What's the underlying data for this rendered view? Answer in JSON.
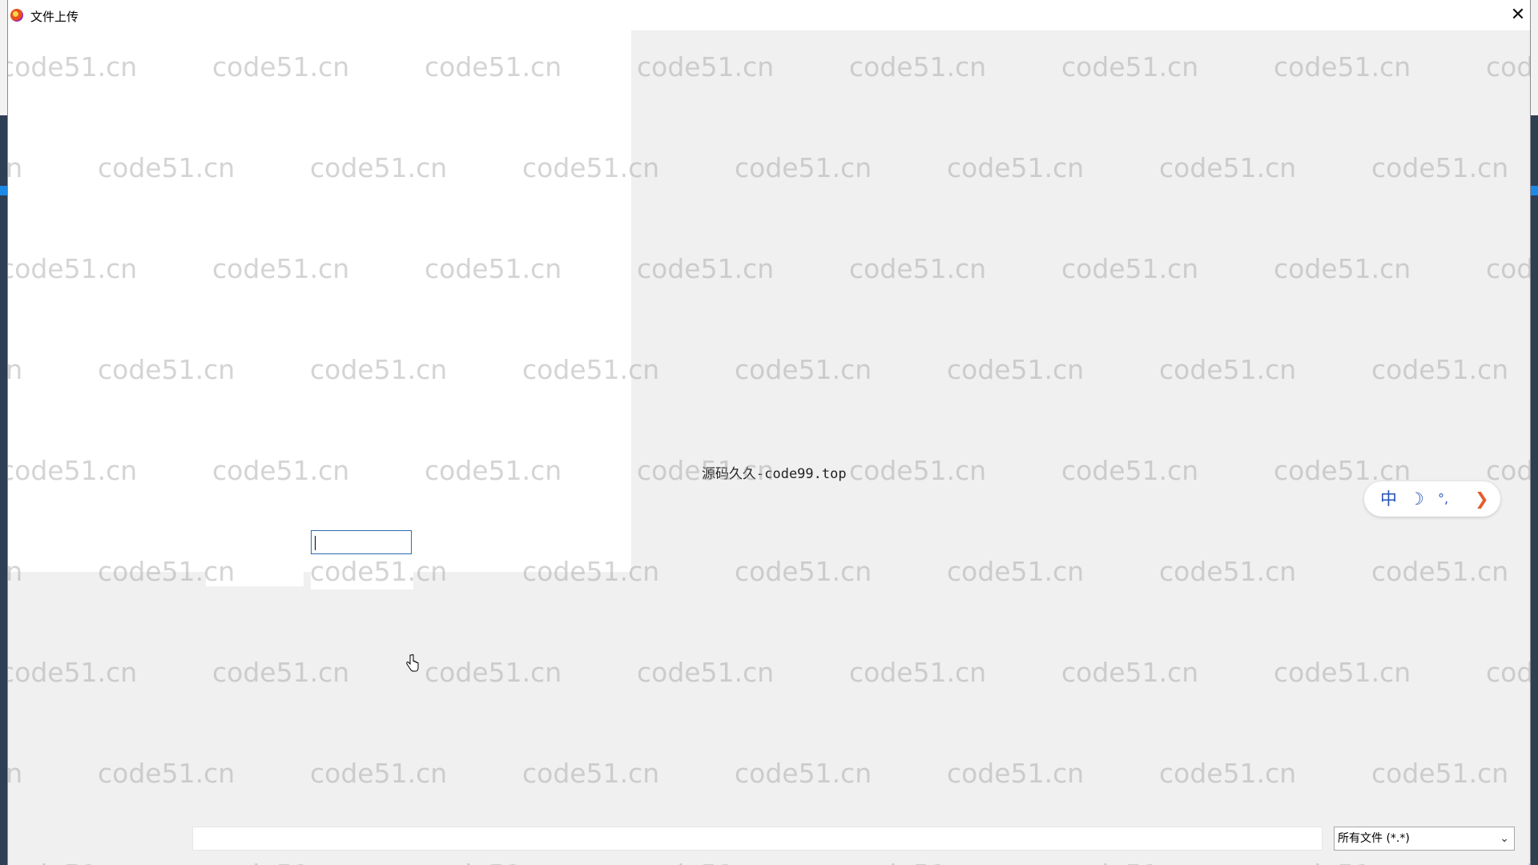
{
  "window": {
    "title": "文件上传",
    "close_symbol": "✕"
  },
  "watermark": {
    "text": "code51.cn"
  },
  "content": {
    "center_text": "源码久久-code99.top"
  },
  "ime_toolbar": {
    "mode": "中",
    "moon": "☽",
    "punct": "°,",
    "arrow": "❯"
  },
  "footer": {
    "filename_value": "",
    "filetype_selected": "所有文件 (*.*)",
    "filetype_chevron": "⌄"
  },
  "colors": {
    "accent_blue": "#2553b5",
    "ime_arrow": "#e55c2c",
    "input_focus_border": "#2b6cb0"
  }
}
